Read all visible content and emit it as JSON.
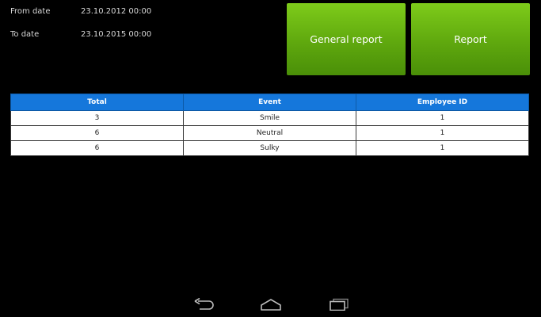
{
  "filters": {
    "from_label": "From date",
    "from_value": "23.10.2012 00:00",
    "to_label": "To date",
    "to_value": "23.10.2015 00:00"
  },
  "buttons": {
    "general_report": "General report",
    "report": "Report"
  },
  "table": {
    "headers": [
      "Total",
      "Event",
      "Employee ID"
    ],
    "rows": [
      [
        "3",
        "Smile",
        "1"
      ],
      [
        "6",
        "Neutral",
        "1"
      ],
      [
        "6",
        "Sulky",
        "1"
      ]
    ]
  },
  "navbar": {
    "icons": [
      "back-icon",
      "home-icon",
      "recent-apps-icon"
    ]
  },
  "colors": {
    "button_green": "#6ab814",
    "header_blue": "#1577db",
    "background": "#000000"
  }
}
